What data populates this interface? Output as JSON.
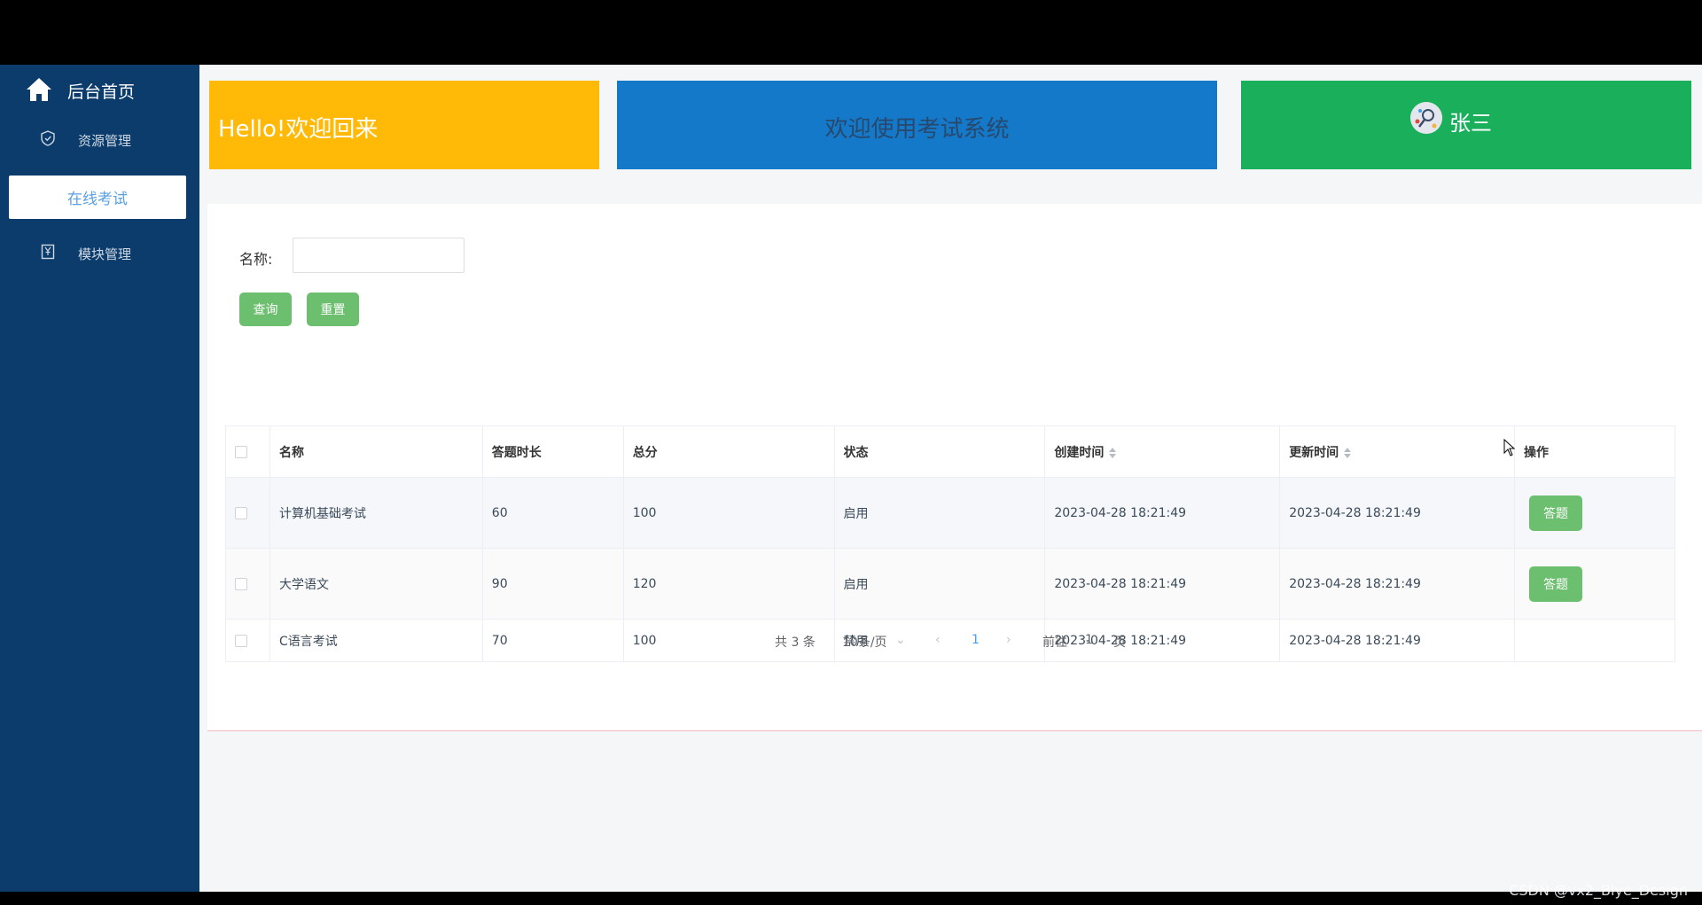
{
  "sidebar": {
    "home_label": "后台首页",
    "items": [
      {
        "label": "资源管理",
        "icon": "shield-icon"
      },
      {
        "label": "在线考试",
        "active": true
      },
      {
        "label": "模块管理",
        "icon": "bookmark-icon"
      }
    ]
  },
  "header": {
    "hello": "Hello!欢迎回来",
    "welcome": "欢迎使用考试系统",
    "username": "张三"
  },
  "search": {
    "label": "名称:",
    "value": "",
    "query_button": "查询",
    "reset_button": "重置"
  },
  "table": {
    "columns": [
      "名称",
      "答题时长",
      "总分",
      "状态",
      "创建时间",
      "更新时间",
      "操作"
    ],
    "rows": [
      {
        "name": "计算机基础考试",
        "duration": "60",
        "score": "100",
        "status": "启用",
        "created": "2023-04-28 18:21:49",
        "updated": "2023-04-28 18:21:49",
        "action": "答题"
      },
      {
        "name": "大学语文",
        "duration": "90",
        "score": "120",
        "status": "启用",
        "created": "2023-04-28 18:21:49",
        "updated": "2023-04-28 18:21:49",
        "action": "答题"
      },
      {
        "name": "C语言考试",
        "duration": "70",
        "score": "100",
        "status": "禁用",
        "created": "2023-04-28 18:21:49",
        "updated": "2023-04-28 18:21:49",
        "action": ""
      }
    ]
  },
  "pagination": {
    "total": "共 3 条",
    "page_size": "10条/页",
    "current_page": "1",
    "goto_prefix": "前往",
    "goto_value": "1",
    "goto_suffix": "页"
  },
  "watermark": "CSDN @vx2_Biye_Design",
  "colors": {
    "sidebar": "#0b3c6b",
    "hello_card": "#ffb906",
    "welcome_card": "#1479c8",
    "user_card": "#19af5b",
    "button": "#6cbf6e"
  }
}
